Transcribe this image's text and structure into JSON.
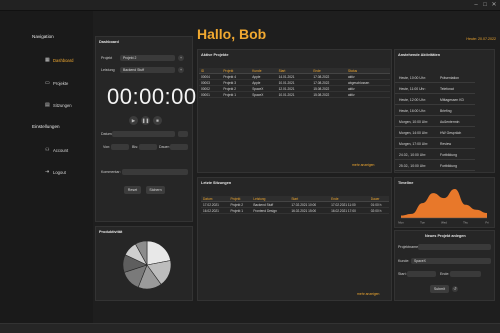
{
  "window": {
    "controls": [
      "–",
      "□",
      "✕"
    ]
  },
  "sidebar": {
    "navigation_title": "Navigation",
    "items": [
      {
        "label": "Dashboard",
        "icon": "dashboard-icon",
        "active": true
      },
      {
        "label": "Projekte",
        "icon": "folder-icon",
        "active": false
      },
      {
        "label": "Sitzungen",
        "icon": "calendar-icon",
        "active": false
      }
    ],
    "settings_title": "Einstellungen",
    "settings_items": [
      {
        "label": "Account",
        "icon": "user-icon"
      },
      {
        "label": "Logout",
        "icon": "logout-icon"
      }
    ]
  },
  "header": {
    "greeting": "Hallo, Bob",
    "date": "Heute: 20.07.2022"
  },
  "accent_color": "#f0a830",
  "timer_panel": {
    "title": "Dashboard",
    "project_label": "Projekt",
    "project_value": "Projekt 2",
    "activity_label": "Leistung",
    "activity_value": "Backend Stuff",
    "time": "00:00:00",
    "date_label": "Datum:",
    "from_label": "Von:",
    "to_label": "Bis:",
    "duration_label": "Dauer:",
    "comment_label": "Kommentar:",
    "reset_label": "Reset",
    "save_label": "Sichern"
  },
  "projects": {
    "title": "Aktive Projekte",
    "columns": [
      "ID",
      "Projekt",
      "Kunde",
      "Start",
      "Ende",
      "Status"
    ],
    "rows": [
      [
        "00004",
        "Projekt 4",
        "Apple",
        "14.01.2021",
        "17.08.2022",
        "aktiv"
      ],
      [
        "00003",
        "Projekt 3",
        "Apple",
        "10.01.2021",
        "17.08.2022",
        "abgeschlossen"
      ],
      [
        "00002",
        "Projekt 2",
        "SpaceX",
        "12.01.2021",
        "15.08.2022",
        "aktiv"
      ],
      [
        "00001",
        "Projekt 1",
        "SpaceX",
        "10.01.2021",
        "15.08.2022",
        "aktiv"
      ]
    ],
    "more_label": "mehr anzeigen"
  },
  "appointments": {
    "title": "Anstehende Aktivitäten",
    "items": [
      {
        "time": "Heute, 10:00 Uhr:",
        "desc": "Präsentation"
      },
      {
        "time": "Heute, 11:00 Uhr:",
        "desc": "Telefonat"
      },
      {
        "time": "Heute, 12:00 Uhr:",
        "desc": "Mittagessen KD"
      },
      {
        "time": "Heute, 16:00 Uhr:",
        "desc": "Briefing"
      },
      {
        "time": "Morgen, 10:00 Uhr:",
        "desc": "Außentermin"
      },
      {
        "time": "Morgen, 14:00 Uhr:",
        "desc": "HW Gespräch"
      },
      {
        "time": "Morgen, 17:00 Uhr:",
        "desc": "Review"
      },
      {
        "time": "24.02., 10:00 Uhr:",
        "desc": "Fortbildung"
      },
      {
        "time": "25.02., 10:00 Uhr:",
        "desc": "Fortbildung"
      }
    ]
  },
  "sessions": {
    "title": "Letzte Sitzungen",
    "columns": [
      "Datum",
      "Projekt",
      "Leistung",
      "Start",
      "Ende",
      "Dauer"
    ],
    "rows": [
      [
        "17.02.2021",
        "Projekt 2",
        "Backend Stuff",
        "17.02.2021 10:00",
        "17.02.2021 11:00",
        "01:00 h"
      ],
      [
        "16.02.2021",
        "Projekt 1",
        "Frontend Design",
        "16.02.2021 15:00",
        "16.02.2021 17:00",
        "02:00 h"
      ]
    ],
    "more_label": "mehr anzeigen"
  },
  "productivity": {
    "title": "Produktivität"
  },
  "timeline": {
    "title": "Timeline",
    "x_ticks": [
      "Mon",
      "Tue",
      "Wed",
      "Thu",
      "Fri"
    ]
  },
  "new_project": {
    "title": "Neues Projekt anlegen",
    "name_label": "Projektname:",
    "client_label": "Kunde:",
    "client_value": "SpaceX",
    "start_label": "Start:",
    "end_label": "Ende:",
    "submit_label": "Submit"
  },
  "chart_data": [
    {
      "type": "pie",
      "title": "",
      "values": [
        22,
        18,
        16,
        14,
        12,
        10,
        8
      ],
      "colors": [
        "#e8e8e8",
        "#bdbdbd",
        "#9a9a9a",
        "#7a7a7a",
        "#5e5e5e",
        "#cfcfcf",
        "#8c8c8c"
      ]
    },
    {
      "type": "area",
      "title": "",
      "x": [
        "Mon",
        "Tue",
        "Wed",
        "Thu",
        "Fri"
      ],
      "series": [
        {
          "values": [
            0.3,
            0.5,
            1.8,
            3.0,
            2.4,
            3.5,
            1.6,
            1.0,
            0.6
          ]
        }
      ],
      "color": "#e8782a"
    }
  ]
}
